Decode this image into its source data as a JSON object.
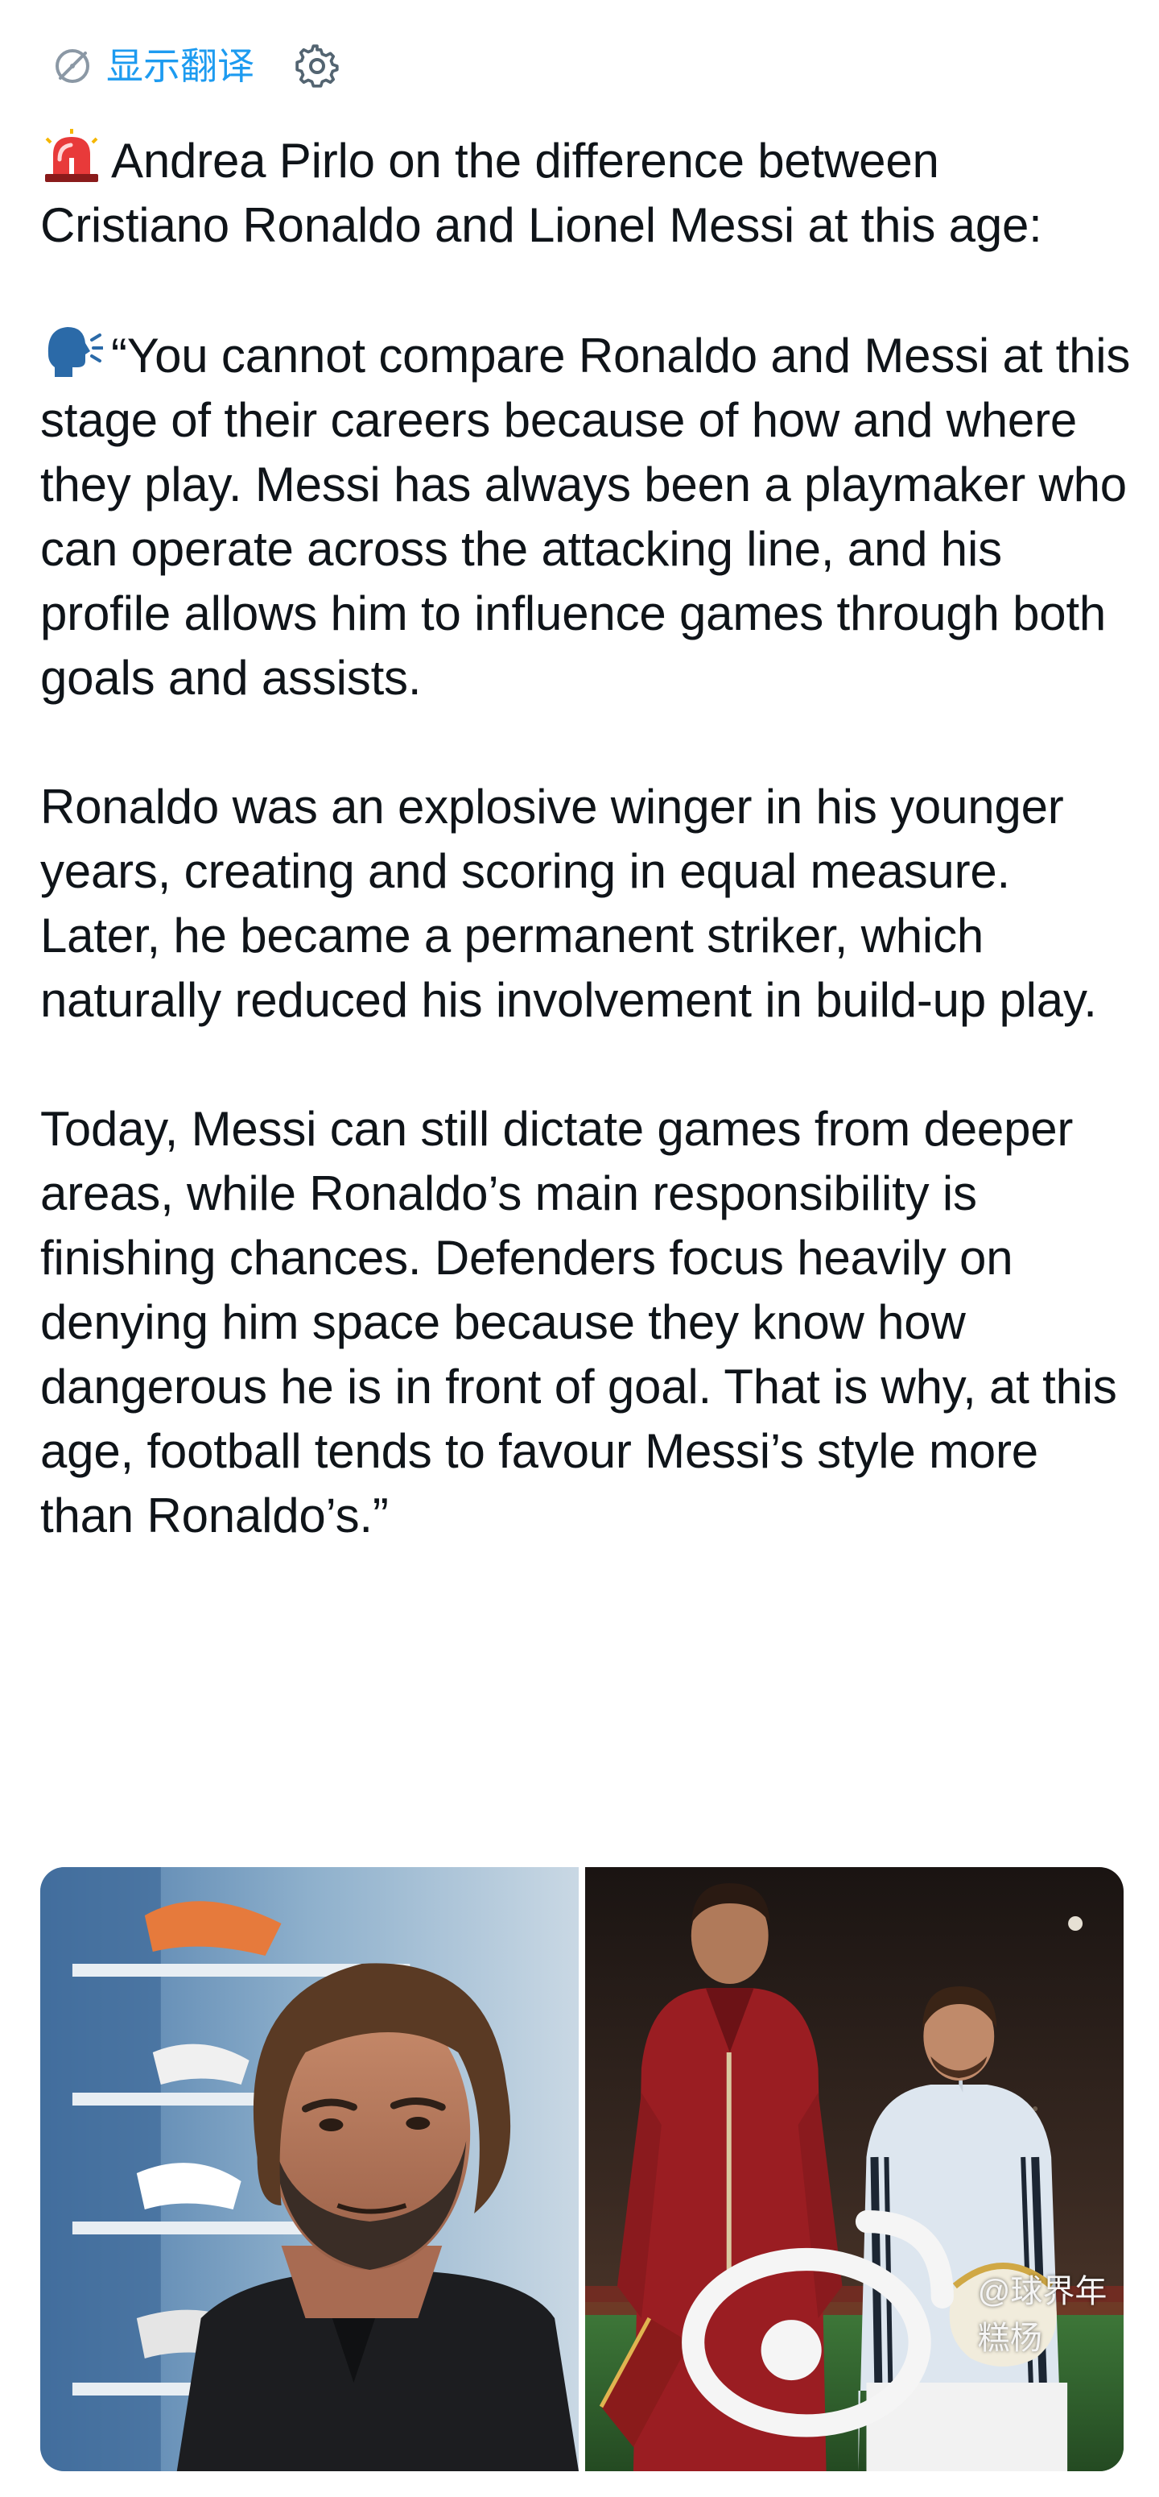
{
  "translate": {
    "label": "显示翻译",
    "icon": "translate-icon",
    "color": "#1d9bf0"
  },
  "settings": {
    "icon": "gear-icon"
  },
  "tweet": {
    "emoji_1": "siren-emoji",
    "paragraph_1": "Andrea Pirlo on the difference between Cristiano Ronaldo and Lionel Messi at this age:",
    "emoji_2": "speaking-head-emoji",
    "paragraph_2": "“You cannot compare Ronaldo and Messi at this stage of their careers because of how and where they play. Messi has always been a playmaker who can operate across the attacking line, and his profile allows him to influence games through both goals and assists.",
    "paragraph_3": "Ronaldo was an explosive winger in his younger years, creating and scoring in equal measure. Later, he became a permanent striker, which naturally reduced his involvement in build-up play.",
    "paragraph_4": "Today, Messi can still dictate games from deeper areas, while Ronaldo’s main responsibility is finishing chances. Defenders focus heavily on denying him space because they know how dangerous he is in front of goal. That is why, at this age, football tends to favour Messi’s style more than Ronaldo’s.”"
  },
  "media": {
    "photo_left": "pirlo-photo",
    "photo_right": "ronaldo-messi-photo",
    "watermark": "@球界年糕杨"
  }
}
